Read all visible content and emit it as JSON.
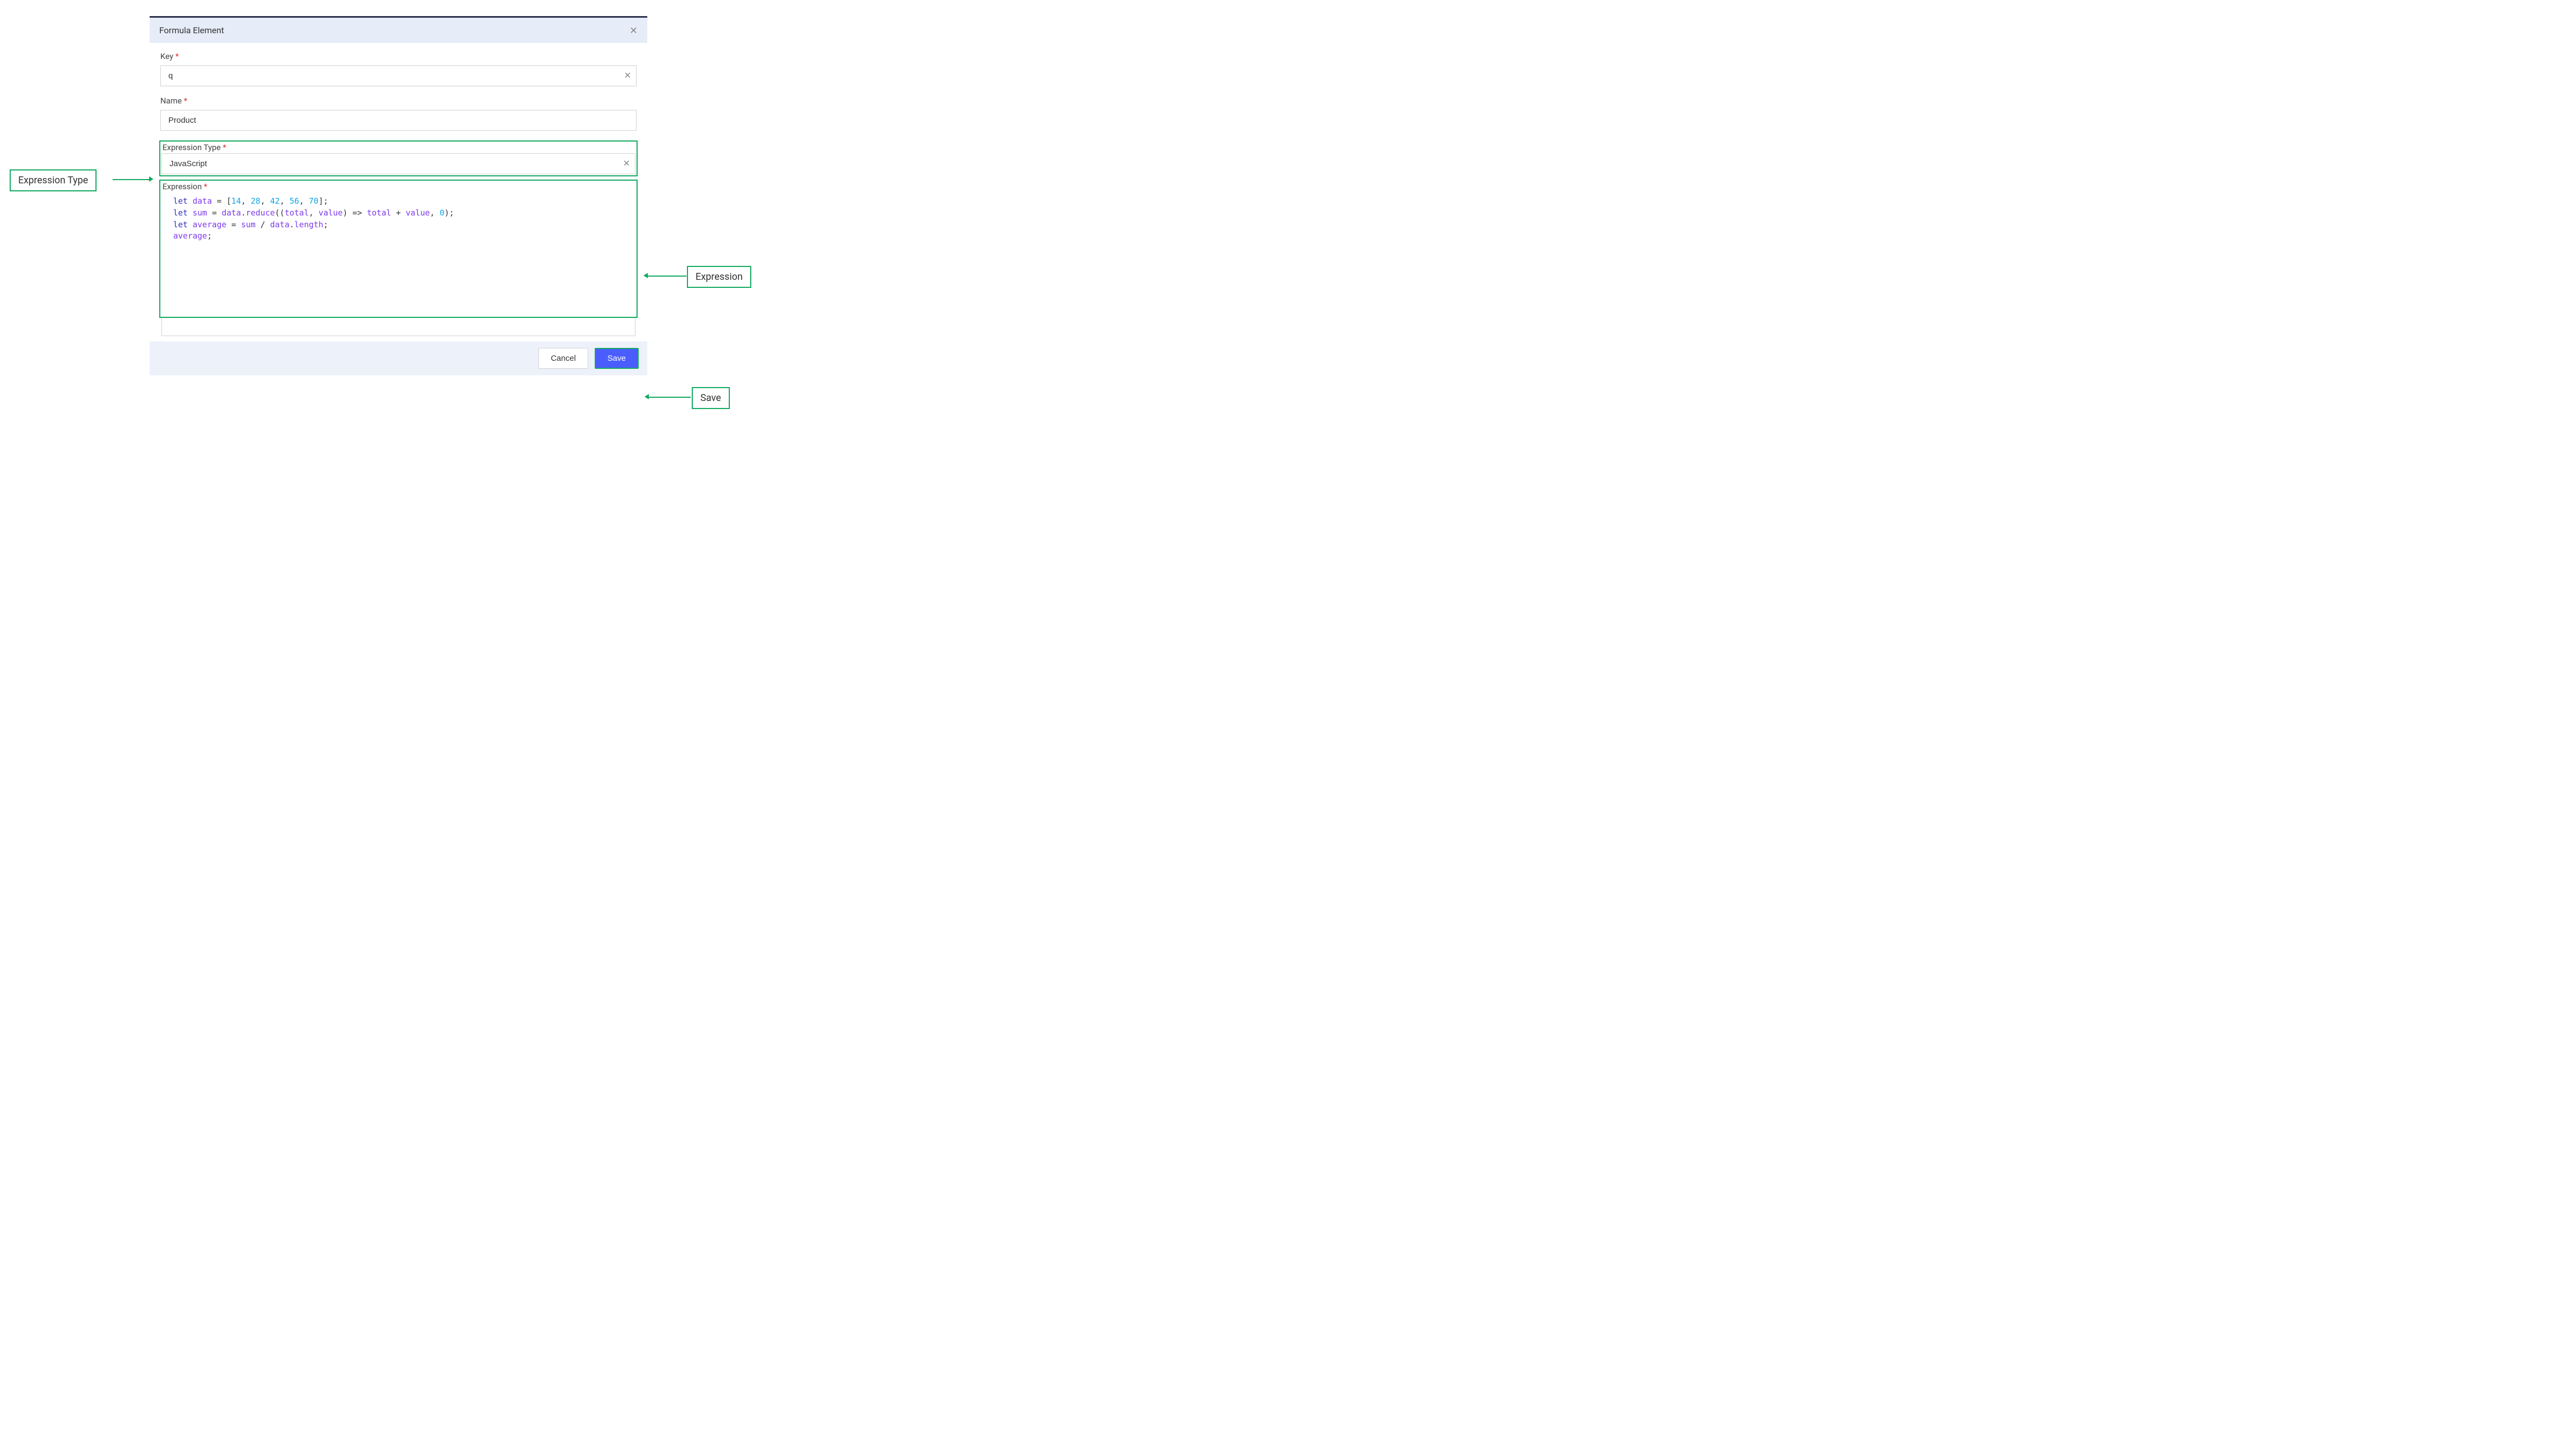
{
  "dialog": {
    "title": "Formula Element",
    "fields": {
      "key_label": "Key",
      "key_value": "q",
      "name_label": "Name",
      "name_value": "Product",
      "expr_type_label": "Expression Type",
      "expr_type_value": "JavaScript",
      "expression_label": "Expression"
    },
    "code": {
      "line1_kw": "let",
      "line1_var": "data",
      "line1_eq": " = [",
      "line1_n1": "14",
      "line1_c1": ", ",
      "line1_n2": "28",
      "line1_c2": ", ",
      "line1_n3": "42",
      "line1_c3": ", ",
      "line1_n4": "56",
      "line1_c4": ", ",
      "line1_n5": "70",
      "line1_end": "];",
      "line2_kw": "let",
      "line2_var": "sum",
      "line2_mid1": " = ",
      "line2_data": "data",
      "line2_dot": ".",
      "line2_fn": "reduce",
      "line2_po": "((",
      "line2_p1": "total",
      "line2_comma": ", ",
      "line2_p2": "value",
      "line2_pc": ") => ",
      "line2_t": "total",
      "line2_plus": " + ",
      "line2_v": "value",
      "line2_cm2": ", ",
      "line2_zero": "0",
      "line2_end": ");",
      "line3_kw": "let",
      "line3_var": "average",
      "line3_eq": " = ",
      "line3_s": "sum",
      "line3_div": " / ",
      "line3_d": "data",
      "line3_dot": ".",
      "line3_len": "length",
      "line3_end": ";",
      "line4_var": "average",
      "line4_end": ";"
    },
    "footer": {
      "cancel": "Cancel",
      "save": "Save"
    }
  },
  "callouts": {
    "expr_type": "Expression Type",
    "expression": "Expression",
    "save": "Save"
  }
}
